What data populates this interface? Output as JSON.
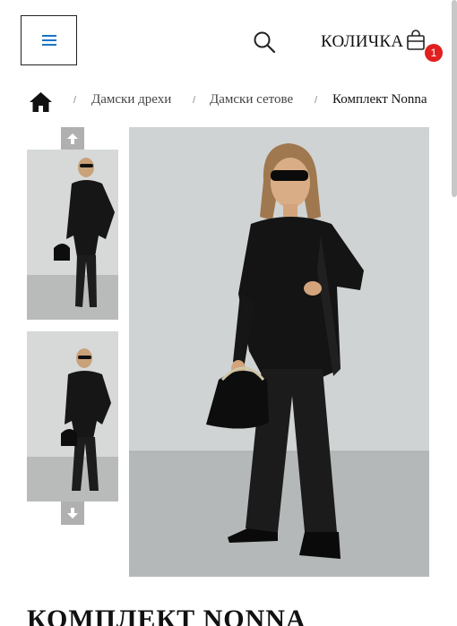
{
  "header": {
    "cart_label": "КОЛИЧКА",
    "cart_count": "1",
    "badge_color": "#e02020",
    "menu_icon_color": "#1a73c8"
  },
  "breadcrumb": {
    "separator": "/",
    "items": [
      {
        "label": "Дамски дрехи"
      },
      {
        "label": "Дамски сетове"
      },
      {
        "label": "Комплект Nonna"
      }
    ]
  },
  "product": {
    "title": "КОМПЛЕКТ NONNA"
  },
  "icons": {
    "menu": "hamburger-icon",
    "search": "search-icon",
    "cart": "shopping-bag-icon",
    "home": "home-icon",
    "thumb_prev": "arrow-up-icon",
    "thumb_next": "arrow-down-icon"
  }
}
